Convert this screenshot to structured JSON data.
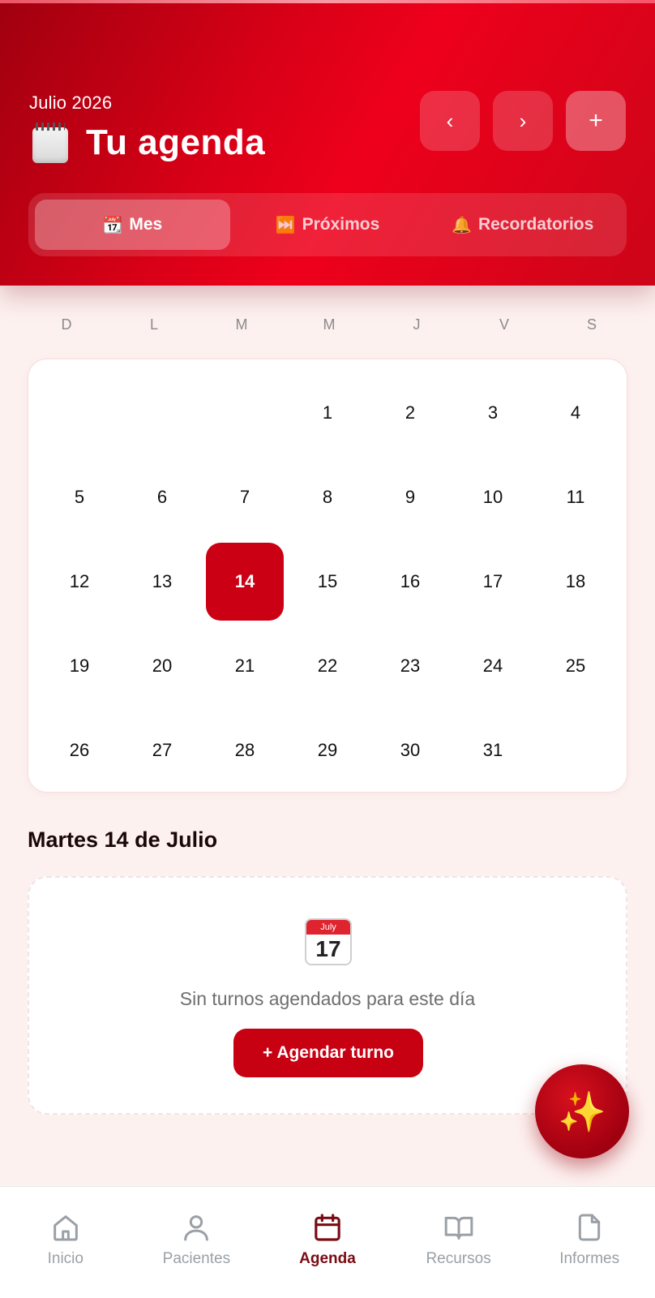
{
  "header": {
    "month_label": "Julio 2026",
    "title": "Tu agenda",
    "prev_label": "‹",
    "next_label": "›",
    "add_label": "+",
    "tabs": [
      {
        "icon": "📆",
        "label": "Mes",
        "active": true
      },
      {
        "icon": "⏭️",
        "label": "Próximos",
        "active": false
      },
      {
        "icon": "🔔",
        "label": "Recordatorios",
        "active": false
      }
    ]
  },
  "calendar": {
    "weekdays": [
      "D",
      "L",
      "M",
      "M",
      "J",
      "V",
      "S"
    ],
    "leading_blanks": 3,
    "days_in_month": 31,
    "selected_day": 14
  },
  "selected": {
    "title": "Martes 14 de Julio",
    "emoji_month": "July",
    "emoji_day": "17",
    "empty_text": "Sin turnos agendados para este día",
    "button_label": "+ Agendar turno"
  },
  "fab": {
    "icon": "✨"
  },
  "nav": {
    "items": [
      {
        "label": "Inicio",
        "icon": "home-icon",
        "active": false
      },
      {
        "label": "Pacientes",
        "icon": "user-icon",
        "active": false
      },
      {
        "label": "Agenda",
        "icon": "calendar-icon",
        "active": true
      },
      {
        "label": "Recursos",
        "icon": "book-icon",
        "active": false
      },
      {
        "label": "Informes",
        "icon": "file-icon",
        "active": false
      }
    ]
  },
  "colors": {
    "primary": "#cc0014",
    "nav_active": "#7a0b12",
    "background": "#fdf1f0"
  }
}
